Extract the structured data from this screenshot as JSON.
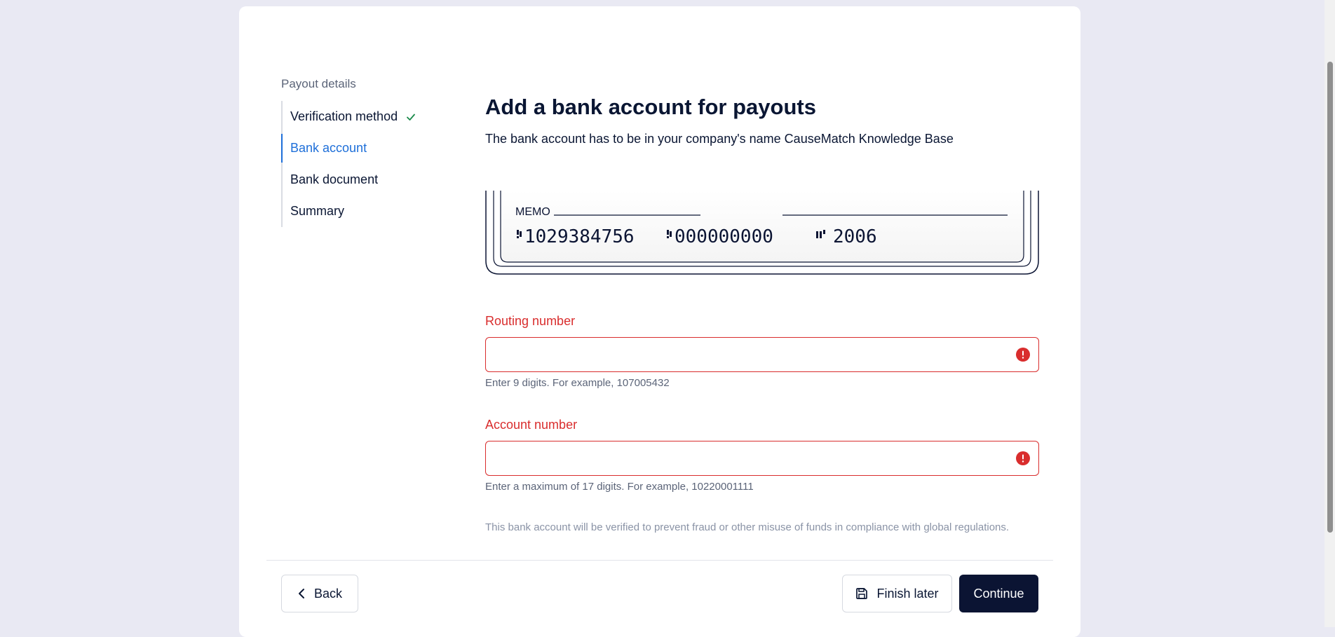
{
  "sidebar": {
    "title": "Payout details",
    "steps": [
      {
        "label": "Verification method",
        "completed": true
      },
      {
        "label": "Bank account",
        "active": true
      },
      {
        "label": "Bank document"
      },
      {
        "label": "Summary"
      }
    ]
  },
  "main": {
    "heading": "Add a bank account for payouts",
    "subheading": "The bank account has to be in your company's name CauseMatch Knowledge Base",
    "cheque": {
      "memo_label": "MEMO",
      "account_number": "1029384756",
      "routing_number": "000000000",
      "check_number": "2006"
    },
    "routing": {
      "label": "Routing number",
      "value": "",
      "hint": "Enter 9 digits. For example, 107005432"
    },
    "account": {
      "label": "Account number",
      "value": "",
      "hint": "Enter a maximum of 17 digits. For example, 10220001111"
    },
    "notice": "This bank account will be verified to prevent fraud or other misuse of funds in compliance with global regulations."
  },
  "footer": {
    "back_label": "Back",
    "finish_later_label": "Finish later",
    "continue_label": "Continue"
  },
  "colors": {
    "accent": "#1e6fd9",
    "error": "#d92d2d",
    "primary_button": "#0b1433",
    "success": "#1a8a4a"
  }
}
